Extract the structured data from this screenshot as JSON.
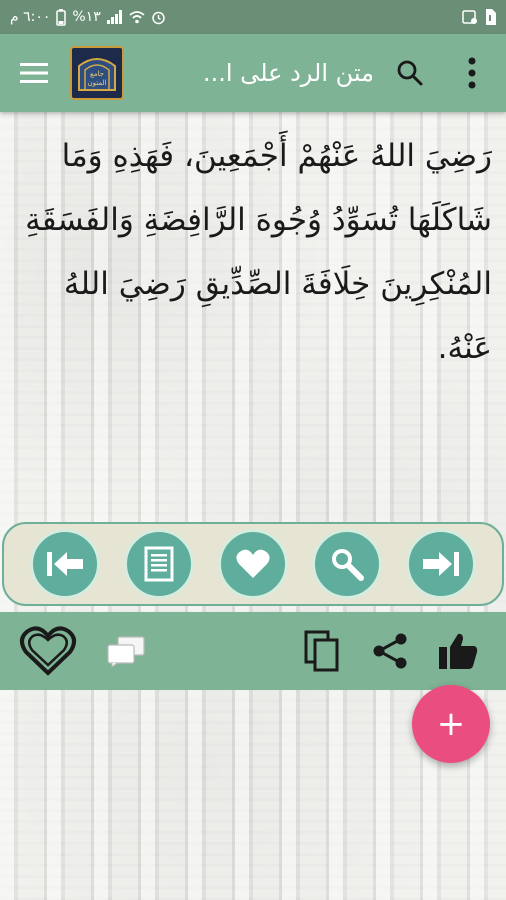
{
  "status_bar": {
    "time": "٦:٠٠ م",
    "battery": "%١٣"
  },
  "app_bar": {
    "title": "متن الرد على ا...",
    "logo_text": "جامع المتون"
  },
  "reading": {
    "lines": [
      "رَضِيَ اللهُ عَنْهُمْ أَجْمَعِينَ، فَهَذِهِ وَمَا",
      "شَاكَلَهَا تُسَوِّدُ وُجُوهَ الرَّافِضَةِ وَالفَسَقَةِ",
      "المُنْكِرِينَ خِلَافَةَ الصِّدِّيقِ رَضِيَ اللهُ",
      "عَنْهُ."
    ]
  },
  "controls": [
    {
      "name": "previous-button",
      "icon": "previous-icon"
    },
    {
      "name": "contents-button",
      "icon": "page-icon"
    },
    {
      "name": "favorite-button",
      "icon": "heart-icon"
    },
    {
      "name": "search-text-button",
      "icon": "magnifier-icon"
    },
    {
      "name": "next-button",
      "icon": "next-icon"
    }
  ],
  "bottom_bar": {
    "icons": [
      "heart-outline-icon",
      "chat-icon",
      "copy-icon",
      "share-icon",
      "thumbs-up-icon"
    ]
  },
  "fab": {
    "label": "+"
  },
  "colors": {
    "status_bar": "#6a8f76",
    "app_bar": "#7fb395",
    "control_bar_bg": "#e6e4d3",
    "control_button": "#5fae9d",
    "fab": "#ea4d7f"
  }
}
